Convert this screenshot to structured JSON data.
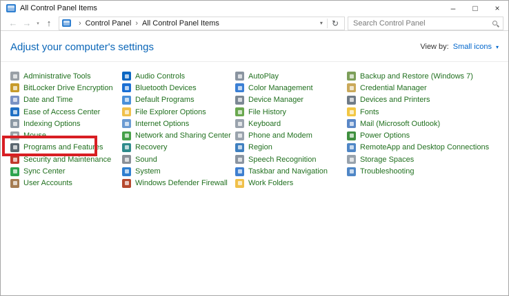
{
  "window": {
    "title": "All Control Panel Items",
    "minimize": "–",
    "maximize": "□",
    "close": "×"
  },
  "toolbar": {
    "back": "←",
    "forward": "→",
    "nav_dropdown": "▾",
    "up": "↑",
    "breadcrumb": [
      "Control Panel",
      "All Control Panel Items"
    ],
    "separator": "›",
    "address_dropdown": "▾",
    "refresh": "↻"
  },
  "search": {
    "placeholder": "Search Control Panel"
  },
  "header": {
    "title": "Adjust your computer's settings",
    "view_by_label": "View by:",
    "view_by_value": "Small icons",
    "view_by_caret": "▾"
  },
  "highlight": {
    "target": "Programs and Features",
    "color": "#d81e23"
  },
  "items": {
    "columns": [
      [
        {
          "label": "Administrative Tools",
          "icon": "administrative-tools",
          "color": "#9aa0a6"
        },
        {
          "label": "BitLocker Drive Encryption",
          "icon": "bitlocker-drive-encryption",
          "color": "#c79b2a"
        },
        {
          "label": "Date and Time",
          "icon": "date-and-time",
          "color": "#7a92c4"
        },
        {
          "label": "Ease of Access Center",
          "icon": "ease-of-access-center",
          "color": "#1f6fc4"
        },
        {
          "label": "Indexing Options",
          "icon": "indexing-options",
          "color": "#8c98a4"
        },
        {
          "label": "Mouse",
          "icon": "mouse",
          "color": "#9aa0a6"
        },
        {
          "label": "Programs and Features",
          "icon": "programs-and-features",
          "color": "#5b6770"
        },
        {
          "label": "Security and Maintenance",
          "icon": "security-and-maintenance",
          "color": "#c0392b"
        },
        {
          "label": "Sync Center",
          "icon": "sync-center",
          "color": "#2da44e"
        },
        {
          "label": "User Accounts",
          "icon": "user-accounts",
          "color": "#a57c52"
        }
      ],
      [
        {
          "label": "Audio Controls",
          "icon": "audio-controls",
          "color": "#0a66c2"
        },
        {
          "label": "Bluetooth Devices",
          "icon": "bluetooth-devices",
          "color": "#1a6fd4"
        },
        {
          "label": "Default Programs",
          "icon": "default-programs",
          "color": "#4a90d9"
        },
        {
          "label": "File Explorer Options",
          "icon": "file-explorer-options",
          "color": "#f0c04a"
        },
        {
          "label": "Internet Options",
          "icon": "internet-options",
          "color": "#6b9bd2"
        },
        {
          "label": "Network and Sharing Center",
          "icon": "network-and-sharing-center",
          "color": "#46a049"
        },
        {
          "label": "Recovery",
          "icon": "recovery",
          "color": "#2e8b8b"
        },
        {
          "label": "Sound",
          "icon": "sound",
          "color": "#8a9097"
        },
        {
          "label": "System",
          "icon": "system",
          "color": "#2f7fd0"
        },
        {
          "label": "Windows Defender Firewall",
          "icon": "windows-defender-firewall",
          "color": "#b5482e"
        }
      ],
      [
        {
          "label": "AutoPlay",
          "icon": "autoplay",
          "color": "#8a94a0"
        },
        {
          "label": "Color Management",
          "icon": "color-management",
          "color": "#3b7fd4"
        },
        {
          "label": "Device Manager",
          "icon": "device-manager",
          "color": "#7c8894"
        },
        {
          "label": "File History",
          "icon": "file-history",
          "color": "#6aa84f"
        },
        {
          "label": "Keyboard",
          "icon": "keyboard",
          "color": "#9aa3ad"
        },
        {
          "label": "Phone and Modem",
          "icon": "phone-and-modem",
          "color": "#9aa3ad"
        },
        {
          "label": "Region",
          "icon": "region",
          "color": "#3f7fbf"
        },
        {
          "label": "Speech Recognition",
          "icon": "speech-recognition",
          "color": "#8a94a0"
        },
        {
          "label": "Taskbar and Navigation",
          "icon": "taskbar-and-navigation",
          "color": "#3f7fd0"
        },
        {
          "label": "Work Folders",
          "icon": "work-folders",
          "color": "#f0c04a"
        }
      ],
      [
        {
          "label": "Backup and Restore (Windows 7)",
          "icon": "backup-and-restore",
          "color": "#7d9f5a"
        },
        {
          "label": "Credential Manager",
          "icon": "credential-manager",
          "color": "#caa95a"
        },
        {
          "label": "Devices and Printers",
          "icon": "devices-and-printers",
          "color": "#6f7b87"
        },
        {
          "label": "Fonts",
          "icon": "fonts",
          "color": "#f2c744"
        },
        {
          "label": "Mail (Microsoft Outlook)",
          "icon": "mail-microsoft-outlook",
          "color": "#5a87c6"
        },
        {
          "label": "Power Options",
          "icon": "power-options",
          "color": "#3f8f3f"
        },
        {
          "label": "RemoteApp and Desktop Connections",
          "icon": "remoteapp-and-desktop-connections",
          "color": "#4f86c6"
        },
        {
          "label": "Storage Spaces",
          "icon": "storage-spaces",
          "color": "#98a2ac"
        },
        {
          "label": "Troubleshooting",
          "icon": "troubleshooting",
          "color": "#4f86c6"
        }
      ]
    ]
  }
}
